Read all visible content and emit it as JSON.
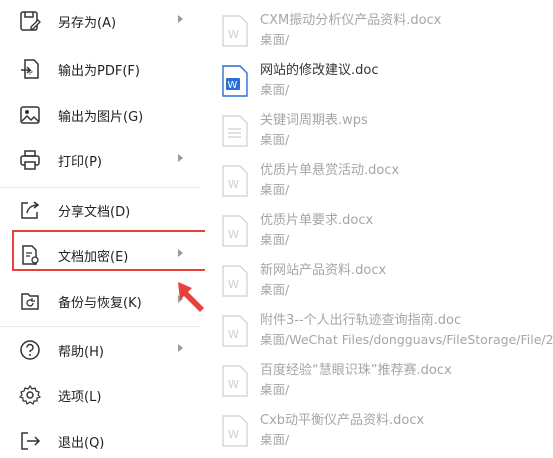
{
  "menu": {
    "items": [
      {
        "label": "另存为(A)",
        "icon": "save-as-icon",
        "submenu": true
      },
      {
        "label": "输出为PDF(F)",
        "icon": "export-pdf-icon",
        "submenu": false
      },
      {
        "label": "输出为图片(G)",
        "icon": "export-image-icon",
        "submenu": false
      },
      {
        "label": "打印(P)",
        "icon": "printer-icon",
        "submenu": true
      },
      {
        "label": "分享文档(D)",
        "icon": "share-icon",
        "submenu": false
      },
      {
        "label": "文档加密(E)",
        "icon": "encrypt-document-icon",
        "submenu": true
      },
      {
        "label": "备份与恢复(K)",
        "icon": "backup-restore-icon",
        "submenu": true
      },
      {
        "label": "帮助(H)",
        "icon": "help-icon",
        "submenu": true
      },
      {
        "label": "选项(L)",
        "icon": "gear-icon",
        "submenu": false
      },
      {
        "label": "退出(Q)",
        "icon": "exit-icon",
        "submenu": false
      }
    ],
    "highlighted_item": "文档加密(E)"
  },
  "recent_files": [
    {
      "name": "CXM振动分析仪产品资料.docx",
      "path": "桌面/",
      "type": "docx"
    },
    {
      "name": "网站的修改建议.doc",
      "path": "桌面/",
      "type": "doc"
    },
    {
      "name": "关键词周期表.wps",
      "path": "桌面/",
      "type": "wps"
    },
    {
      "name": "优质片单悬赏活动.docx",
      "path": "桌面/",
      "type": "docx"
    },
    {
      "name": "优质片单要求.docx",
      "path": "桌面/",
      "type": "docx"
    },
    {
      "name": "新网站产品资料.docx",
      "path": "桌面/",
      "type": "docx"
    },
    {
      "name": "附件3--个人出行轨迹查询指南.doc",
      "path": "桌面/WeChat Files/dongguavs/FileStorage/File/2...",
      "type": "doc"
    },
    {
      "name": "百度经验“慧眼识珠”推荐赛.docx",
      "path": "桌面/",
      "type": "docx"
    },
    {
      "name": "Cxb动平衡仪产品资料.docx",
      "path": "桌面/",
      "type": "docx"
    }
  ],
  "colors": {
    "highlight_border": "#e8403a",
    "annotation_arrow": "#e8403a",
    "word_icon_blue": "#2b6fd6",
    "muted_text": "#a6a6a6"
  }
}
